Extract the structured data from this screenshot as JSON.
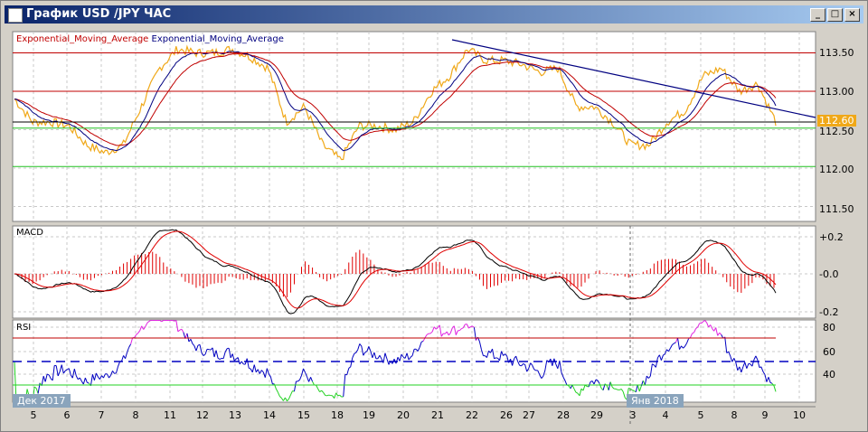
{
  "window": {
    "title": "График USD /JPY  ЧАС",
    "min": "_",
    "max": "□",
    "close": "×"
  },
  "indicators": {
    "ema1": "Exponential_Moving_Average",
    "ema2": "Exponential_Moving_Average",
    "macd": "MACD",
    "rsi": "RSI"
  },
  "price_axis": [
    "113.50",
    "113.00",
    "112.50",
    "112.00",
    "111.50"
  ],
  "current_price": "112.60",
  "macd_axis": [
    "+0.2",
    "-0.0",
    "-0.2"
  ],
  "rsi_axis": [
    "80",
    "60",
    "40"
  ],
  "period_tags": {
    "start": "Дек 2017",
    "jan": "Янв 2018"
  },
  "x_labels": [
    "5",
    "6",
    "7",
    "8",
    "11",
    "12",
    "13",
    "14",
    "15",
    "18",
    "19",
    "20",
    "21",
    "22",
    "26",
    "27",
    "28",
    "29",
    "3",
    "4",
    "5",
    "8",
    "9",
    "10"
  ],
  "colors": {
    "ema_red": "#c00000",
    "ema_blue": "#000080",
    "price": "#f0a818",
    "trend": "#000080"
  },
  "chart_data": {
    "type": "line",
    "price_keypoints": [
      112.9,
      112.6,
      112.6,
      112.55,
      112.3,
      112.2,
      112.3,
      112.8,
      113.3,
      113.55,
      113.5,
      113.5,
      113.55,
      113.45,
      113.3,
      112.6,
      112.8,
      112.3,
      112.1,
      112.55,
      112.55,
      112.5,
      112.6,
      113.0,
      113.2,
      113.55,
      113.4,
      113.4,
      113.35,
      113.25,
      113.3,
      112.8,
      112.8,
      112.6,
      112.3,
      112.3,
      112.6,
      112.75,
      113.2,
      113.3,
      113.0,
      113.1,
      112.6
    ],
    "levels": {
      "red": [
        113.5,
        113.0
      ],
      "black": 112.6,
      "green": [
        112.52,
        112.02
      ]
    },
    "rsi_levels": [
      70,
      50,
      30
    ]
  }
}
